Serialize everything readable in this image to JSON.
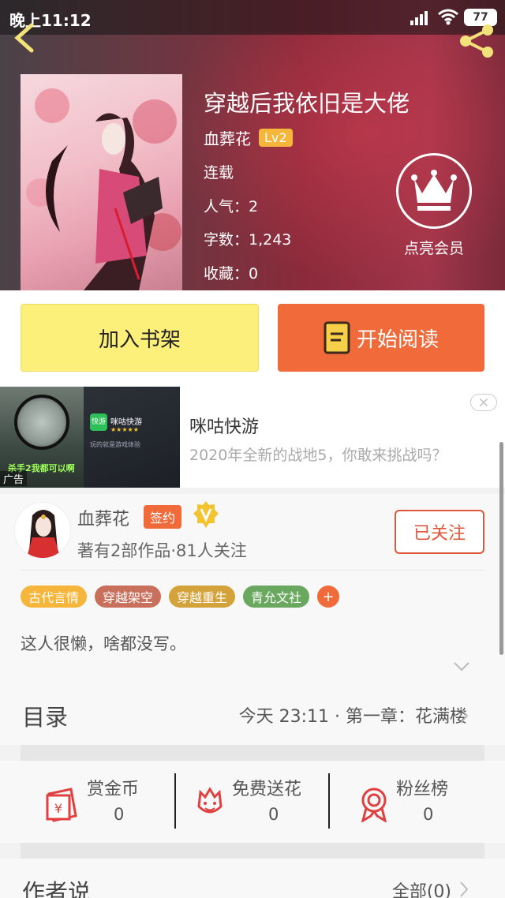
{
  "status_bar": {
    "time": "晚上11:12",
    "battery": "77"
  },
  "book": {
    "title": "穿越后我依旧是大佬",
    "author": "血葬花",
    "level": "Lv2",
    "status": "连载",
    "popularity": "人气：2",
    "word_count": "字数：1,243",
    "favorites": "收藏：0"
  },
  "vip": {
    "label": "点亮会员"
  },
  "actions": {
    "add_shelf": "加入书架",
    "start_read": "开始阅读"
  },
  "ad": {
    "title": "咪咕快游",
    "description": "2020年全新的战地5，你敢来挑战吗？",
    "tag": "广告",
    "image_caption": "杀手2我都可以啊",
    "app_tile": "快游",
    "app_name": "咪咕快游",
    "app_stars": "★★★★★",
    "app_desc": "玩的就是游戏体验"
  },
  "author": {
    "name": "血葬花",
    "sign_badge": "签约",
    "stats": "著有2部作品·81人关注",
    "follow_label": "已关注",
    "tags": [
      {
        "label": "古代言情",
        "color": "#f6b63c"
      },
      {
        "label": "穿越架空",
        "color": "#c9705c"
      },
      {
        "label": "穿越重生",
        "color": "#d4a23a"
      },
      {
        "label": "青允文社",
        "color": "#6aa860"
      }
    ],
    "tag_add": "+",
    "tag_add_color": "#f06a3a",
    "intro": "这人很懒，啥都没写。"
  },
  "toc": {
    "title": "目录",
    "latest": "今天 23:11 · 第一章：花满楼"
  },
  "gifts": [
    {
      "label": "赏金币",
      "count": "0"
    },
    {
      "label": "免费送花",
      "count": "0"
    },
    {
      "label": "粉丝榜",
      "count": "0"
    }
  ],
  "author_say": {
    "title": "作者说",
    "all": "全部(0)"
  },
  "colors": {
    "accent": "#f06a3a",
    "shelf_button": "#fdf07a",
    "follow": "#e0563a",
    "hero": "#8a2a3a"
  }
}
